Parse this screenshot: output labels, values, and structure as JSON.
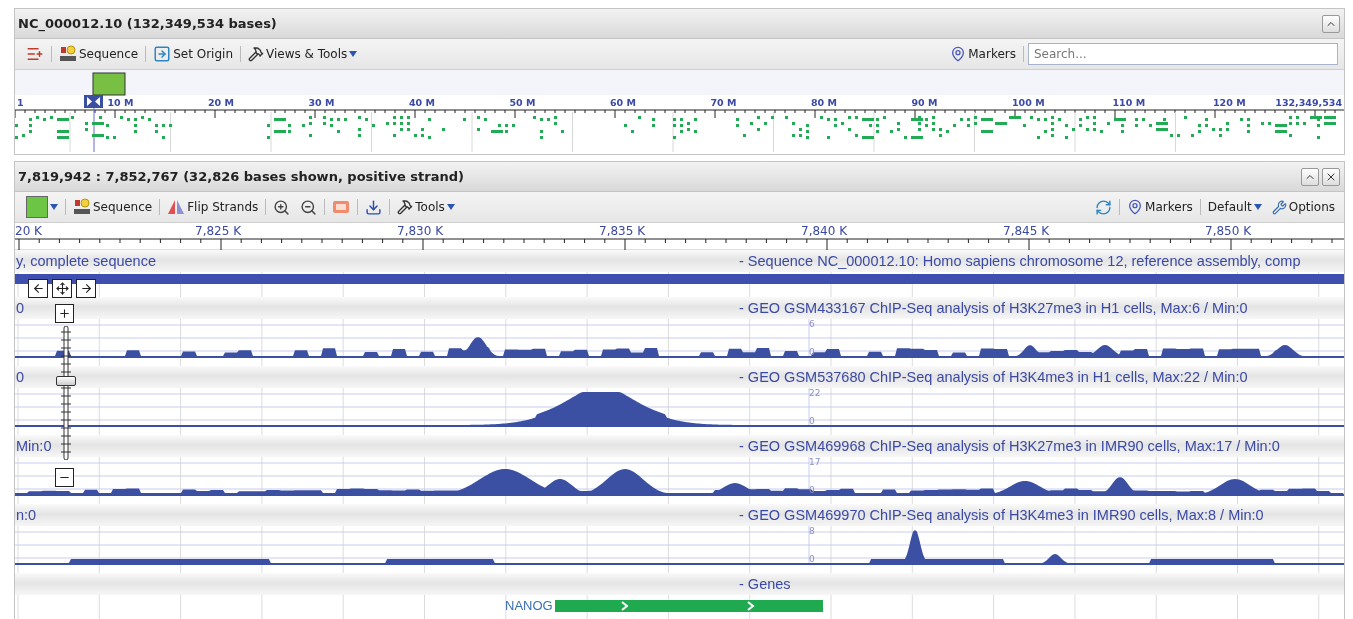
{
  "overview_panel": {
    "title": "NC_000012.10 (132,349,534 bases)",
    "toolbar": [
      {
        "kind": "tracks"
      },
      {
        "kind": "sequence",
        "label": "Sequence"
      },
      {
        "kind": "origin",
        "label": "Set Origin"
      },
      {
        "kind": "tools",
        "label": "Views & Tools",
        "dropdown": true
      }
    ],
    "markers_label": "Markers",
    "search": {
      "placeholder": "Search..."
    },
    "ruler_labels": [
      "1",
      "10 M",
      "20 M",
      "30 M",
      "40 M",
      "50 M",
      "60 M",
      "70 M",
      "80 M",
      "90 M",
      "100 M",
      "110 M",
      "120 M",
      "132,349,534"
    ]
  },
  "detail_panel": {
    "title": "7,819,942 : 7,852,767 (32,826 bases shown, positive strand)",
    "toolbar_left": [
      {
        "kind": "color",
        "color": "#6cc644",
        "dropdown": true
      },
      {
        "kind": "sequence",
        "label": "Sequence"
      },
      {
        "kind": "flip",
        "label": "Flip Strands"
      },
      {
        "kind": "zoom_in"
      },
      {
        "kind": "zoom_out"
      },
      {
        "kind": "atg"
      },
      {
        "kind": "download"
      },
      {
        "kind": "tools",
        "label": "Tools",
        "dropdown": true
      }
    ],
    "toolbar_right": [
      {
        "kind": "refresh"
      },
      {
        "kind": "markers",
        "label": "Markers"
      },
      {
        "kind": "preset",
        "label": "Default",
        "dropdown": true
      },
      {
        "kind": "options",
        "label": "Options"
      }
    ],
    "ruler_labels": [
      "20 K",
      "7,825 K",
      "7,830 K",
      "7,835 K",
      "7,840 K",
      "7,845 K",
      "7,850 K"
    ],
    "tracks": [
      {
        "kind": "sequence",
        "left_label": "y, complete sequence",
        "title": "- Sequence NC_000012.10: Homo sapiens chromosome 12, reference assembly, comp"
      },
      {
        "kind": "graph",
        "left_label": "0",
        "title": "- GEO GSM433167 ChIP-Seq analysis of H3K27me3 in H1 cells, Max:6 / Min:0",
        "axis_max": "6",
        "axis_min": "0"
      },
      {
        "kind": "graph",
        "left_label": "0",
        "title": "- GEO GSM537680 ChIP-Seq analysis of H3K4me3 in H1 cells, Max:22 / Min:0",
        "axis_max": "22",
        "axis_min": "0"
      },
      {
        "kind": "graph",
        "left_label": "Min:0",
        "title": "- GEO GSM469968 ChIP-Seq analysis of H3K27me3 in IMR90 cells, Max:17 / Min:0",
        "axis_max": "17",
        "axis_min": "0"
      },
      {
        "kind": "graph",
        "left_label": "n:0",
        "title": "- GEO GSM469970 ChIP-Seq analysis of H3K4me3 in IMR90 cells, Max:8 / Min:0",
        "axis_max": "8",
        "axis_min": "0"
      },
      {
        "kind": "genes",
        "title": "- Genes",
        "genes": [
          {
            "name": "NANOG"
          }
        ]
      }
    ]
  },
  "zoom_slider": {
    "level": 0.6
  }
}
